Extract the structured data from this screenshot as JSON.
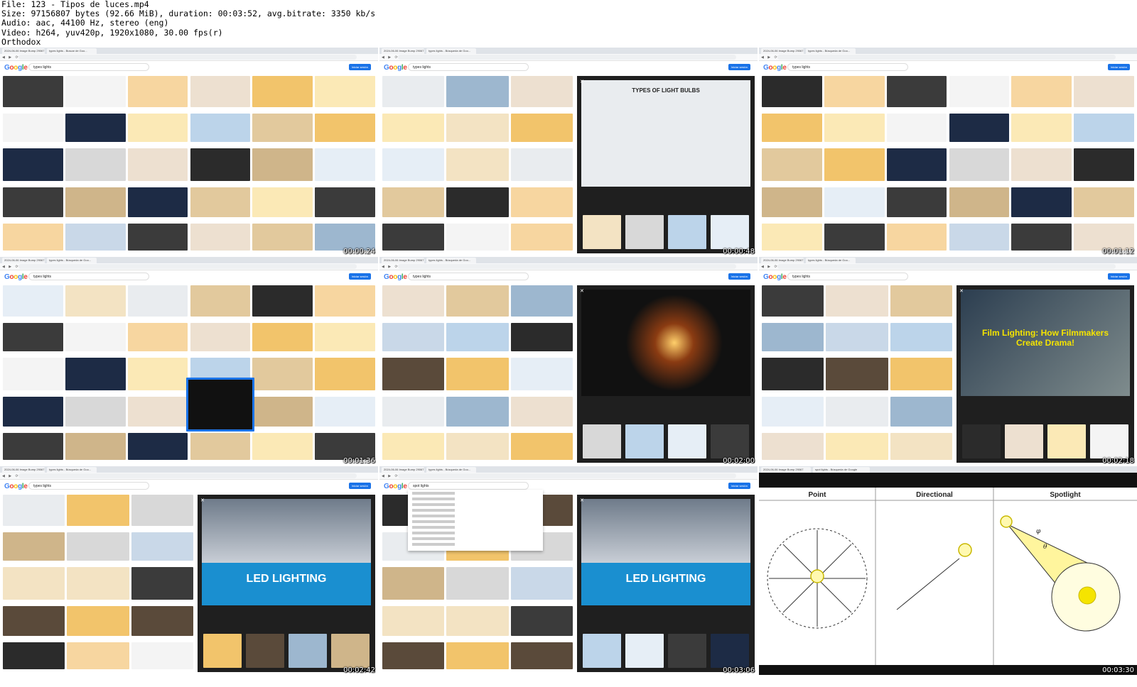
{
  "file_info": [
    "File: 123 - Tipos de luces.mp4",
    "Size: 97156807 bytes (92.66 MiB), duration: 00:03:52, avg.bitrate: 3350 kb/s",
    "Audio: aac, 44100 Hz, stereo (eng)",
    "Video: h264, yuv420p, 1920x1080, 30.00 fps(r)",
    "Orthodox"
  ],
  "frames": [
    {
      "time": "00:00:24",
      "query": "types lights",
      "viewer": "",
      "tabs": [
        "2024-06-06 Image Bump 29067",
        "types lights - Buscar de Goo..."
      ]
    },
    {
      "time": "00:00:48",
      "query": "types lights",
      "viewer": "TYPES OF LIGHT BULBS",
      "tabs": [
        "2024-06-06 Image Bump 29067",
        "types lights - Búsqueda de Goo..."
      ]
    },
    {
      "time": "00:01:12",
      "query": "types lights",
      "viewer": "",
      "tabs": [
        "2024-06-06 Image Bump 29067",
        "types lights - Búsqueda de Goo..."
      ]
    },
    {
      "time": "00:01:36",
      "query": "types lights",
      "viewer": "",
      "tabs": [
        "2024-06-06 Image Bump 29067",
        "types lights - Búsqueda de Goo..."
      ]
    },
    {
      "time": "00:02:00",
      "query": "types lights",
      "viewer": "",
      "tabs": [
        "2024-06-06 Image Bump 29067",
        "types lights - Búsqueda de Goo..."
      ]
    },
    {
      "time": "00:02:18",
      "query": "types lights",
      "viewer": "Film Lighting: How Filmmakers Create Drama!",
      "tabs": [
        "2024-06-06 Image Bump 29067",
        "types lights - Búsqueda de Goo..."
      ]
    },
    {
      "time": "00:02:42",
      "query": "types lights",
      "viewer": "LED LIGHTING",
      "tabs": [
        "2024-06-06 Image Bump 29067",
        "types lights - Búsqueda de Goo..."
      ]
    },
    {
      "time": "00:03:06",
      "query": "spot lights",
      "viewer": "LED LIGHTING",
      "tabs": [
        "2024-06-06 Image Bump 29067",
        "types lights - Búsqueda de Goo..."
      ]
    },
    {
      "time": "00:03:30",
      "query": "",
      "viewer": "",
      "tabs": [
        "2024-06-06 Image Bump 29067",
        "spot lights - Búsqueda de Google"
      ]
    }
  ],
  "google_logo": [
    "G",
    "o",
    "o",
    "g",
    "l",
    "e"
  ],
  "search_button": "Iniciar sesión",
  "final_slide": {
    "col1": "Point",
    "col2": "Directional",
    "col3": "Spotlight",
    "phi": "φ",
    "theta": "θ"
  },
  "colors": {
    "google_blue": "#1a73e8",
    "viewer_bg": "#1f1f1f",
    "bulb_yellow": "#f5e400"
  }
}
